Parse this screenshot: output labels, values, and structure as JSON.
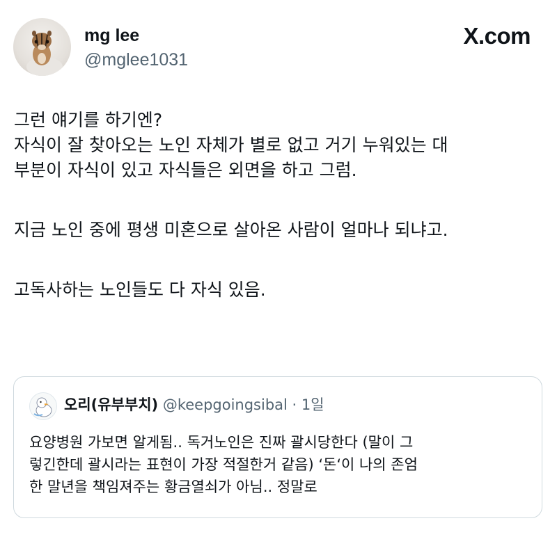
{
  "author": {
    "display_name": "mg lee",
    "handle": "@mglee1031"
  },
  "brand": {
    "label": "X.com"
  },
  "tweet": {
    "lines": [
      "그런 얘기를 하기엔?",
      "자식이 잘 찾아오는 노인 자체가 별로 없고 거기 누워있는 대",
      "부분이 자식이 있고 자식들은 외면을 하고 그럼.",
      "지금 노인 중에 평생 미혼으로 살아온 사람이 얼마나 되냐고.",
      "고독사하는 노인들도 다 자식 있음."
    ]
  },
  "quote": {
    "display_name": "오리(유부부치)",
    "handle": "@keepgoingsibal",
    "separator": "·",
    "time": "1일",
    "lines": [
      "요양병원 가보면 알게됨.. 독거노인은 진짜 괄시당한다 (말이 그",
      "렇긴한데 괄시라는 표현이 가장 적절한거 같음) ‘돈‘이 나의 존엄",
      "한 말년을 책임져주는 황금열쇠가 아님.. 정말로"
    ]
  },
  "icons": {
    "author_avatar": "chipmunk-avatar-icon",
    "quote_avatar": "duck-avatar-icon"
  }
}
